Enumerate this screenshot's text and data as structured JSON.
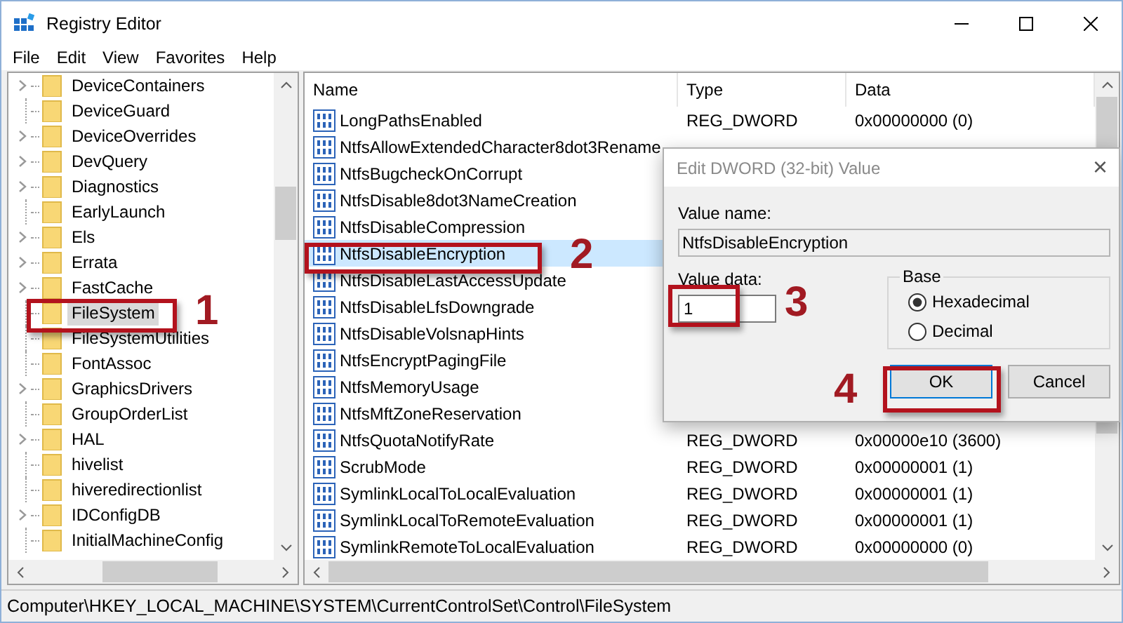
{
  "window": {
    "title": "Registry Editor"
  },
  "menu": [
    "File",
    "Edit",
    "View",
    "Favorites",
    "Help"
  ],
  "tree": {
    "items": [
      {
        "label": "DeviceContainers",
        "expandable": true,
        "selected": false
      },
      {
        "label": "DeviceGuard",
        "expandable": false,
        "selected": false
      },
      {
        "label": "DeviceOverrides",
        "expandable": true,
        "selected": false
      },
      {
        "label": "DevQuery",
        "expandable": true,
        "selected": false
      },
      {
        "label": "Diagnostics",
        "expandable": true,
        "selected": false
      },
      {
        "label": "EarlyLaunch",
        "expandable": false,
        "selected": false
      },
      {
        "label": "Els",
        "expandable": true,
        "selected": false
      },
      {
        "label": "Errata",
        "expandable": true,
        "selected": false
      },
      {
        "label": "FastCache",
        "expandable": true,
        "selected": false
      },
      {
        "label": "FileSystem",
        "expandable": false,
        "selected": true
      },
      {
        "label": "FileSystemUtilities",
        "expandable": false,
        "selected": false
      },
      {
        "label": "FontAssoc",
        "expandable": false,
        "selected": false
      },
      {
        "label": "GraphicsDrivers",
        "expandable": true,
        "selected": false
      },
      {
        "label": "GroupOrderList",
        "expandable": false,
        "selected": false
      },
      {
        "label": "HAL",
        "expandable": true,
        "selected": false
      },
      {
        "label": "hivelist",
        "expandable": false,
        "selected": false
      },
      {
        "label": "hiveredirectionlist",
        "expandable": false,
        "selected": false
      },
      {
        "label": "IDConfigDB",
        "expandable": true,
        "selected": false
      },
      {
        "label": "InitialMachineConfig",
        "expandable": false,
        "selected": false
      }
    ]
  },
  "values": {
    "columns": [
      "Name",
      "Type",
      "Data"
    ],
    "rows": [
      {
        "name": "LongPathsEnabled",
        "type": "REG_DWORD",
        "data": "0x00000000 (0)",
        "selected": false
      },
      {
        "name": "NtfsAllowExtendedCharacter8dot3Rename",
        "selected": false
      },
      {
        "name": "NtfsBugcheckOnCorrupt",
        "selected": false
      },
      {
        "name": "NtfsDisable8dot3NameCreation",
        "selected": false
      },
      {
        "name": "NtfsDisableCompression",
        "selected": false
      },
      {
        "name": "NtfsDisableEncryption",
        "selected": true
      },
      {
        "name": "NtfsDisableLastAccessUpdate",
        "selected": false
      },
      {
        "name": "NtfsDisableLfsDowngrade",
        "selected": false
      },
      {
        "name": "NtfsDisableVolsnapHints",
        "selected": false
      },
      {
        "name": "NtfsEncryptPagingFile",
        "selected": false
      },
      {
        "name": "NtfsMemoryUsage",
        "selected": false
      },
      {
        "name": "NtfsMftZoneReservation",
        "selected": false
      },
      {
        "name": "NtfsQuotaNotifyRate",
        "type": "REG_DWORD",
        "data": "0x00000e10 (3600)",
        "selected": false
      },
      {
        "name": "ScrubMode",
        "type": "REG_DWORD",
        "data": "0x00000001 (1)",
        "selected": false
      },
      {
        "name": "SymlinkLocalToLocalEvaluation",
        "type": "REG_DWORD",
        "data": "0x00000001 (1)",
        "selected": false
      },
      {
        "name": "SymlinkLocalToRemoteEvaluation",
        "type": "REG_DWORD",
        "data": "0x00000001 (1)",
        "selected": false
      },
      {
        "name": "SymlinkRemoteToLocalEvaluation",
        "type": "REG_DWORD",
        "data": "0x00000000 (0)",
        "selected": false
      }
    ]
  },
  "status_bar": "Computer\\HKEY_LOCAL_MACHINE\\SYSTEM\\CurrentControlSet\\Control\\FileSystem",
  "dialog": {
    "title": "Edit DWORD (32-bit) Value",
    "close": "×",
    "name_label": "Value name:",
    "name_value": "NtfsDisableEncryption",
    "data_label": "Value data:",
    "data_value": "1",
    "base_label": "Base",
    "base_options": [
      {
        "label": "Hexadecimal",
        "selected": true
      },
      {
        "label": "Decimal",
        "selected": false
      }
    ],
    "buttons": [
      "OK",
      "Cancel"
    ]
  },
  "annotations": [
    {
      "number": "1"
    },
    {
      "number": "2"
    },
    {
      "number": "3"
    },
    {
      "number": "4"
    }
  ]
}
